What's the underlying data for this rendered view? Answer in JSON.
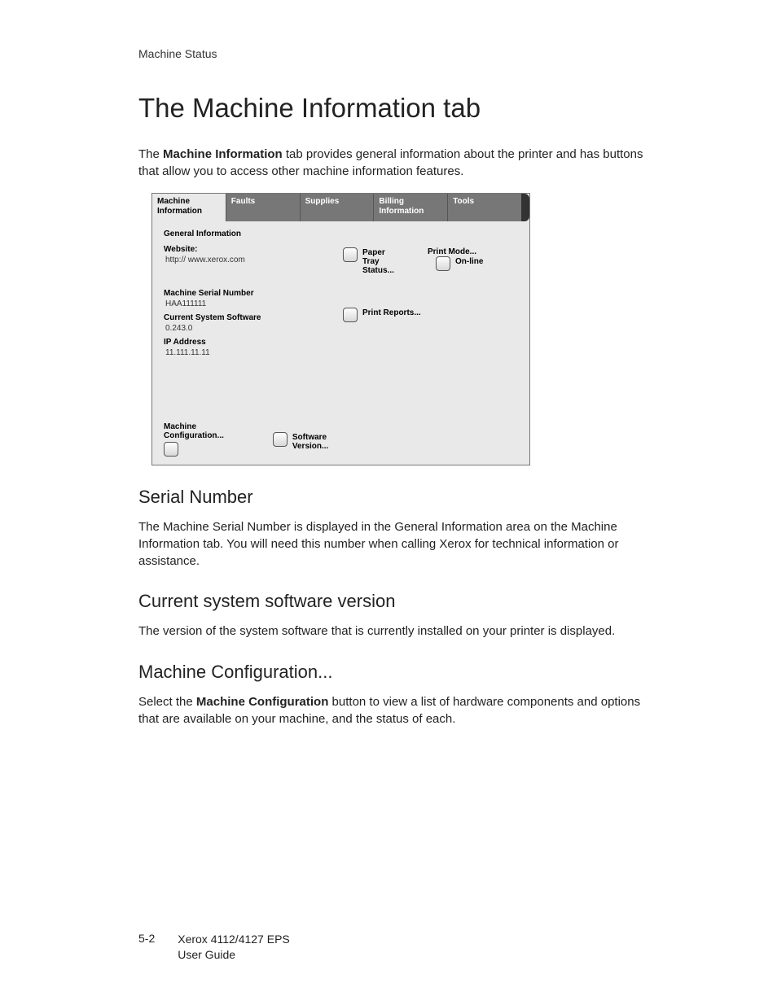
{
  "header": {
    "section": "Machine Status"
  },
  "title": "The Machine Information tab",
  "intro_a": "The ",
  "intro_bold": "Machine Information",
  "intro_b": " tab provides general information about the printer and has buttons that allow you to access other machine information features.",
  "ui": {
    "tabs": [
      "Machine Information",
      "Faults",
      "Supplies",
      "Billing Information",
      "Tools"
    ],
    "gen_info": "General Information",
    "website_label": "Website:",
    "website_value": "http:// www.xerox.com",
    "serial_label": "Machine Serial Number",
    "serial_value": "HAA111111",
    "sw_label": "Current System Software",
    "sw_value": "0.243.0",
    "ip_label": "IP Address",
    "ip_value": "11.111.11.11",
    "config_btn": "Machine Configuration...",
    "swver_btn": "Software Version...",
    "papertray_btn": "Paper Tray Status...",
    "reports_btn": "Print Reports...",
    "printmode_label": "Print Mode...",
    "printmode_btn": "On-line"
  },
  "sections": {
    "serial_h": "Serial Number",
    "serial_p": "The Machine Serial Number is displayed in the General Information area on the Machine Information tab. You will need this number when calling Xerox for technical information or assistance.",
    "sw_h": "Current system software version",
    "sw_p": "The version of the system software that is currently installed on your printer is displayed.",
    "cfg_h": "Machine Configuration...",
    "cfg_p_a": "Select the ",
    "cfg_p_bold": "Machine Configuration",
    "cfg_p_b": " button to view a list of hardware components and options that are available on your machine, and the status of each."
  },
  "footer": {
    "page": "5-2",
    "line1": "Xerox 4112/4127 EPS",
    "line2": "User Guide"
  }
}
